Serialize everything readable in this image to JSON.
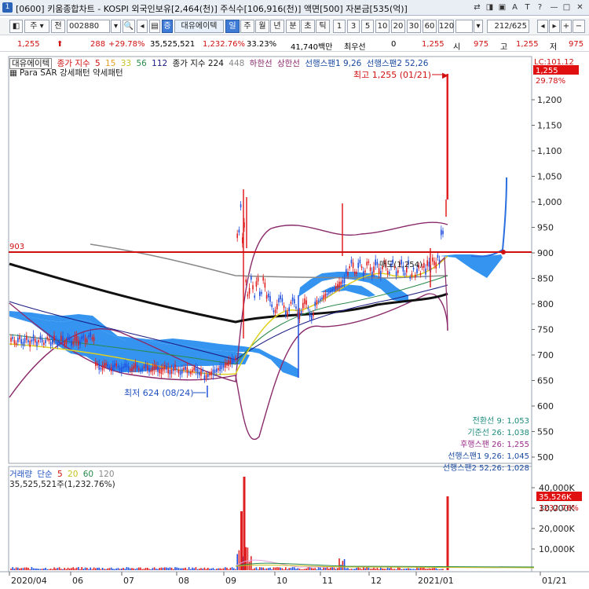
{
  "window": {
    "icon": "1",
    "title": "[0600] 키움종합차트 - KOSPI 외국인보유[2,464(천)] 주식수[106,916(천)] 액면[500] 자본금[535(억)]"
  },
  "toolbar": {
    "mode_label": "주",
    "prev_label": "전",
    "code_value": "002880",
    "stock_name": "대유에이텍",
    "periods": [
      "일",
      "주",
      "월",
      "년",
      "분",
      "초",
      "틱"
    ],
    "selected_period": "일",
    "intervals": [
      "1",
      "3",
      "5",
      "10",
      "20",
      "30",
      "60",
      "120"
    ],
    "page_counter": "212/625"
  },
  "quote": {
    "price": "1,255",
    "change": "288",
    "change_pct": "+29.78%",
    "volume": "35,525,521",
    "volume_pct": "1,232.76%",
    "turnover": "33.23%",
    "amount": "41,740백만",
    "priority_label": "최우선",
    "priority_value": "0",
    "best_value": "1,255",
    "open_label": "시",
    "open_value": "975",
    "high_label": "고",
    "high_value": "1,255",
    "low_label": "저",
    "low_value": "975"
  },
  "price_panel": {
    "legend": {
      "name": "대유에이텍",
      "close_label": "종가 지수",
      "ma": [
        "5",
        "15",
        "33",
        "56",
        "112"
      ],
      "close2_label": "종가 지수 224",
      "extra": "448",
      "lower_label": "하한선",
      "upper_label": "상한선",
      "span1": "선행스팬1 9,26",
      "span2": "선행스팬2 52,26"
    },
    "legend2": "Para SAR 강세패턴  약세패턴",
    "lc_label": "LC:101.12",
    "current_price_tag": "1,255",
    "current_pct_tag": "29.78%",
    "high_annotation": "최고 1,255 (01/21)",
    "low_annotation": "최저 624 (08/24)",
    "horizontal_line_label": "903",
    "buy_label": "매도(1,254)",
    "y_ticks": [
      "1,200",
      "1,150",
      "1,100",
      "1,050",
      "1,000",
      "950",
      "900",
      "850",
      "800",
      "750",
      "700",
      "650",
      "600",
      "550",
      "500"
    ],
    "ichimoku": [
      {
        "label": "전환선 9: 1,053",
        "color": "#1a8a7a"
      },
      {
        "label": "기준선 26: 1,038",
        "color": "#1a8a7a"
      },
      {
        "label": "후행스팬 26: 1,255",
        "color": "#9a2a8a"
      },
      {
        "label": "선행스팬1 9,26: 1,045",
        "color": "#1a4aa0"
      },
      {
        "label": "선행스팬2 52,26: 1,028",
        "color": "#1a4aa0"
      }
    ]
  },
  "volume_panel": {
    "legend": {
      "name": "거래량",
      "ma_label": "단순",
      "ma": [
        "5",
        "20",
        "60",
        "120"
      ]
    },
    "value_label": "35,525,521주(1,232.76%)",
    "current_tag": "35,526K",
    "current_pct_tag": "1232.76%",
    "y_ticks": [
      "40,000K",
      "30,000K",
      "20,000K",
      "10,000K"
    ]
  },
  "x_axis": [
    "2020/04",
    "06",
    "07",
    "08",
    "09",
    "10",
    "11",
    "12",
    "2021/01",
    "01/21"
  ],
  "colors": {
    "up": "#e02020",
    "down": "#2050e0",
    "cloud": "#2a8ff0",
    "hline": "#d01010",
    "tag_bg": "#e01010"
  }
}
